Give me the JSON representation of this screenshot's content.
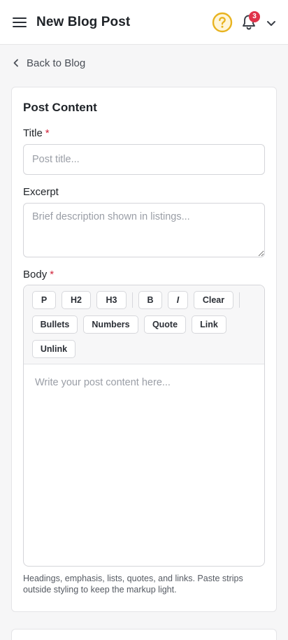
{
  "header": {
    "title": "New Blog Post",
    "notification_count": "3",
    "accent_color": "#e8b320",
    "badge_color": "#e0334a"
  },
  "nav": {
    "back_label": "Back to Blog"
  },
  "form": {
    "card_title": "Post Content",
    "title_field": {
      "label": "Title",
      "required_mark": "*",
      "value": "",
      "placeholder": "Post title..."
    },
    "excerpt_field": {
      "label": "Excerpt",
      "value": "",
      "placeholder": "Brief description shown in listings..."
    },
    "body_field": {
      "label": "Body",
      "required_mark": "*",
      "placeholder": "Write your post content here...",
      "toolbar": {
        "paragraph": "P",
        "h2": "H2",
        "h3": "H3",
        "bold": "B",
        "italic": "I",
        "clear": "Clear",
        "bullets": "Bullets",
        "numbers": "Numbers",
        "quote": "Quote",
        "link": "Link",
        "unlink": "Unlink"
      },
      "help_text": "Headings, emphasis, lists, quotes, and links. Paste strips outside styling to keep the markup light."
    }
  },
  "icons": [
    "menu-icon",
    "help-circle-icon",
    "bell-icon",
    "chevron-down-icon",
    "chevron-left-icon"
  ]
}
